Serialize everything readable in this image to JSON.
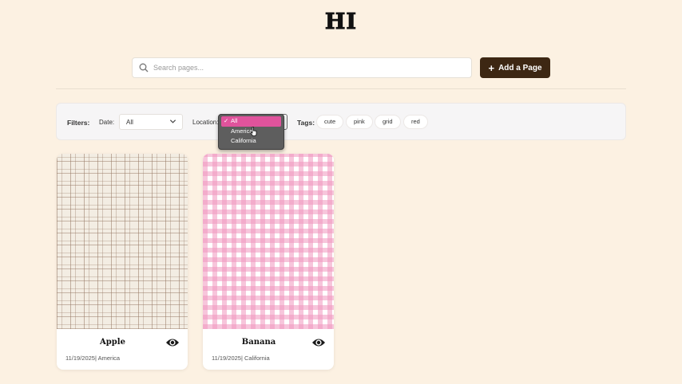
{
  "header": {
    "title": "HI"
  },
  "search": {
    "placeholder": "Search pages...",
    "value": ""
  },
  "actions": {
    "add_page_label": "Add a Page"
  },
  "filters": {
    "label": "Filters:",
    "date": {
      "label": "Date:",
      "selected": "All"
    },
    "location": {
      "label": "Location:",
      "options": [
        "All",
        "America",
        "California"
      ],
      "selected": "All"
    },
    "tags": {
      "label": "Tags:",
      "items": [
        "cute",
        "pink",
        "grid",
        "red"
      ]
    }
  },
  "cards": [
    {
      "name": "Apple",
      "meta": "11/19/2025| America"
    },
    {
      "name": "Banana",
      "meta": "11/19/2025| California"
    }
  ],
  "colors": {
    "background": "#fcf1e2",
    "primary_button": "#3d2713",
    "dropdown_highlight": "#e0539c"
  },
  "icons": [
    "search-icon",
    "plus-icon",
    "chevron-down-icon",
    "check-icon",
    "eye-icon",
    "pointer-cursor-icon"
  ]
}
